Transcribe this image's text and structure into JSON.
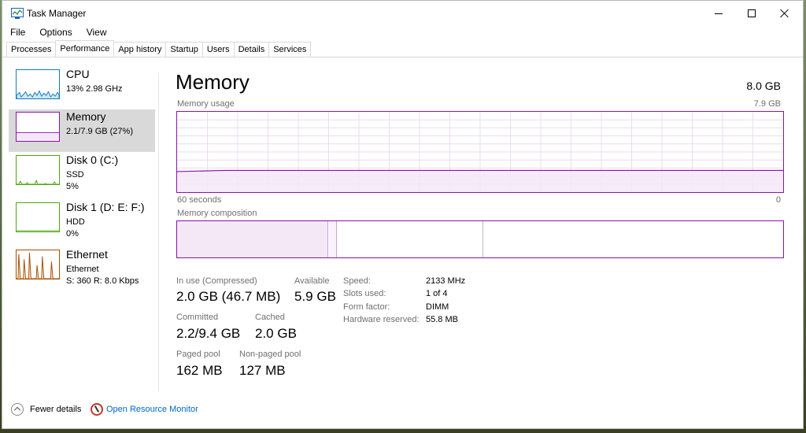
{
  "window": {
    "title": "Task Manager"
  },
  "menu": [
    "File",
    "Options",
    "View"
  ],
  "tabs": [
    "Processes",
    "Performance",
    "App history",
    "Startup",
    "Users",
    "Details",
    "Services"
  ],
  "active_tab": "Performance",
  "sidebar": [
    {
      "name": "CPU",
      "line1": "13% 2.98 GHz",
      "line2": "",
      "color": "#117dbb"
    },
    {
      "name": "Memory",
      "line1": "2.1/7.9 GB (27%)",
      "line2": "",
      "color": "#8b12ae"
    },
    {
      "name": "Disk 0 (C:)",
      "line1": "SSD",
      "line2": "5%",
      "color": "#4da60c"
    },
    {
      "name": "Disk 1 (D: E: F:)",
      "line1": "HDD",
      "line2": "0%",
      "color": "#4da60c"
    },
    {
      "name": "Ethernet",
      "line1": "Ethernet",
      "line2": "S: 360  R: 8.0 Kbps",
      "color": "#a74f01"
    }
  ],
  "main": {
    "title": "Memory",
    "total": "8.0 GB",
    "usage_label": "Memory usage",
    "usage_max": "7.9 GB",
    "time_left": "60 seconds",
    "time_right": "0",
    "composition_label": "Memory composition",
    "usage_fraction": 0.27
  },
  "stats": {
    "in_use_label": "In use (Compressed)",
    "in_use_value": "2.0 GB (46.7 MB)",
    "available_label": "Available",
    "available_value": "5.9 GB",
    "committed_label": "Committed",
    "committed_value": "2.2/9.4 GB",
    "cached_label": "Cached",
    "cached_value": "2.0 GB",
    "paged_label": "Paged pool",
    "paged_value": "162 MB",
    "nonpaged_label": "Non-paged pool",
    "nonpaged_value": "127 MB"
  },
  "details": [
    {
      "label": "Speed:",
      "value": "2133 MHz"
    },
    {
      "label": "Slots used:",
      "value": "1 of 4"
    },
    {
      "label": "Form factor:",
      "value": "DIMM"
    },
    {
      "label": "Hardware reserved:",
      "value": "55.8 MB"
    }
  ],
  "footer": {
    "fewer_details": "Fewer details",
    "resource_monitor": "Open Resource Monitor"
  }
}
